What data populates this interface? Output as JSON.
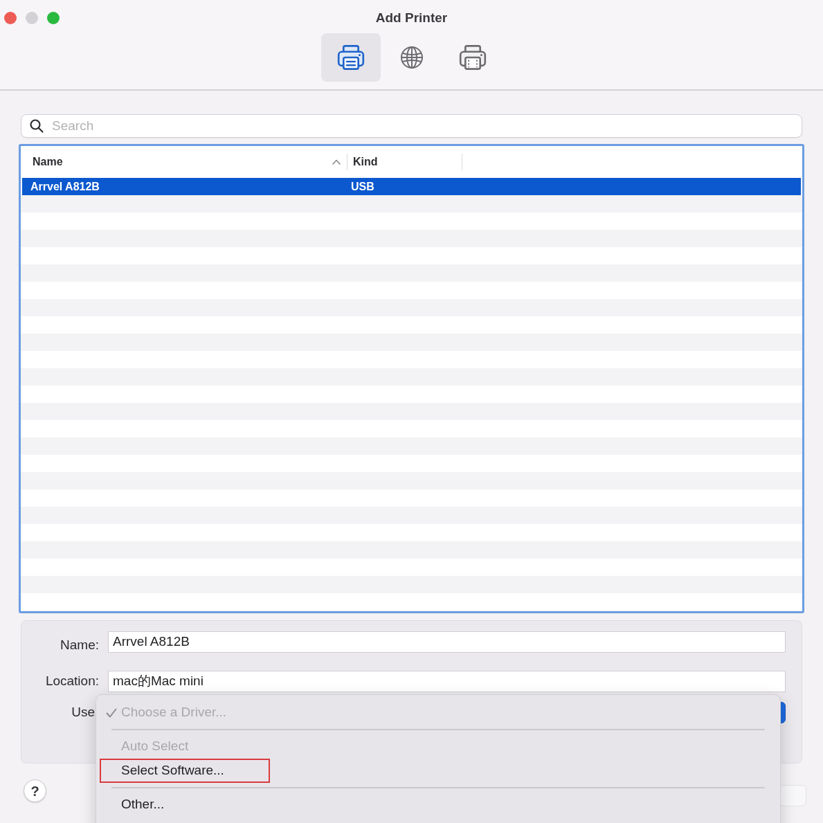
{
  "window": {
    "title": "Add Printer",
    "controls": [
      {
        "color": "#ee5c56"
      },
      {
        "color": "#d3d1d5"
      },
      {
        "color": "#2ab93f"
      }
    ]
  },
  "toolbar": {
    "tabs": [
      {
        "kind": "local",
        "selected": true
      },
      {
        "kind": "network",
        "selected": false
      },
      {
        "kind": "windows",
        "selected": false
      }
    ]
  },
  "search": {
    "placeholder": "Search"
  },
  "table": {
    "columns": [
      {
        "label": "Name",
        "sorted": true
      },
      {
        "label": "Kind",
        "sorted": false
      }
    ],
    "rows": [
      {
        "cells": [
          "Arrvel A812B",
          "USB"
        ],
        "selected": true
      }
    ]
  },
  "form": {
    "fields": [
      {
        "label": "Name:",
        "value": "Arrvel A812B"
      },
      {
        "label": "Location:",
        "value": "mac的Mac mini"
      }
    ],
    "use_label": "Use"
  },
  "help_button": {
    "label": "?"
  },
  "menu": {
    "items": [
      {
        "kind": "item",
        "label": "Choose a Driver...",
        "checked": true,
        "disabled": true,
        "highlighted": false
      },
      {
        "kind": "separator"
      },
      {
        "kind": "item",
        "label": "Auto Select",
        "checked": false,
        "disabled": true,
        "highlighted": false
      },
      {
        "kind": "item",
        "label": "Select Software...",
        "checked": false,
        "disabled": false,
        "highlighted": true
      },
      {
        "kind": "separator"
      },
      {
        "kind": "item",
        "label": "Other...",
        "checked": false,
        "disabled": false,
        "highlighted": false
      }
    ]
  }
}
